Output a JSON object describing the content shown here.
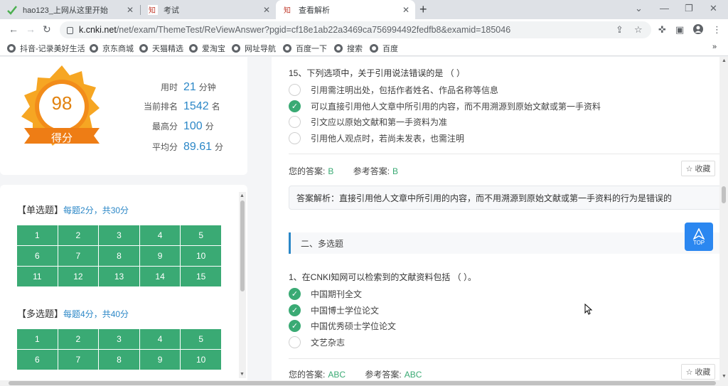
{
  "browser": {
    "tabs": [
      {
        "title": "hao123_上网从这里开始"
      },
      {
        "title": "考试"
      },
      {
        "title": "查看解析"
      }
    ],
    "url_host": "k.cnki.net",
    "url_path": "/net/exam/ThemeTest/ReViewAnswer?pgid=cf18e1ab22a3469ca756994492fedfb8&examid=185046",
    "bookmarks": [
      "抖音-记录美好生活",
      "京东商城",
      "天猫精选",
      "爱淘宝",
      "网址导航",
      "百度一下",
      "搜索",
      "百度"
    ],
    "more_bookmarks": "»"
  },
  "score": {
    "value": "98",
    "label": "得分",
    "stats": [
      {
        "label": "用时",
        "value": "21",
        "unit": "分钟"
      },
      {
        "label": "当前排名",
        "value": "1542",
        "unit": "名"
      },
      {
        "label": "最高分",
        "value": "100",
        "unit": "分"
      },
      {
        "label": "平均分",
        "value": "89.61",
        "unit": "分"
      }
    ]
  },
  "nav": {
    "single": {
      "title": "【单选题】",
      "note": "每题2分，共30分",
      "items": [
        "1",
        "2",
        "3",
        "4",
        "5",
        "6",
        "7",
        "8",
        "9",
        "10",
        "11",
        "12",
        "13",
        "14",
        "15"
      ]
    },
    "multi": {
      "title": "【多选题】",
      "note": "每题4分，共40分",
      "items": [
        "1",
        "2",
        "3",
        "4",
        "5",
        "6",
        "7",
        "8",
        "9",
        "10"
      ]
    }
  },
  "question15": {
    "title": "15、下列选项中，关于引用说法错误的是 （ ）",
    "options": [
      {
        "text": "引用需注明出处，包括作者姓名、作品名称等信息",
        "checked": false
      },
      {
        "text": "可以直接引用他人文章中所引用的内容，而不用溯源到原始文献或第一手资料",
        "checked": true
      },
      {
        "text": "引文应以原始文献和第一手资料为准",
        "checked": false
      },
      {
        "text": "引用他人观点时，若尚未发表，也需注明",
        "checked": false
      }
    ],
    "your_answer_label": "您的答案:",
    "your_answer": "B",
    "ref_answer_label": "参考答案:",
    "ref_answer": "B",
    "collect": "收藏",
    "analysis": "答案解析：直接引用他人文章中所引用的内容，而不用溯源到原始文献或第一手资料的行为是错误的"
  },
  "section2": {
    "title": "二、多选题"
  },
  "multi1": {
    "title": "1、在CNKI知网可以检索到的文献资料包括 （ ）。",
    "options": [
      {
        "text": "中国期刊全文",
        "checked": true
      },
      {
        "text": "中国博士学位论文",
        "checked": true
      },
      {
        "text": "中国优秀硕士学位论文",
        "checked": true
      },
      {
        "text": "文艺杂志",
        "checked": false
      }
    ],
    "your_answer_label": "您的答案:",
    "your_answer": "ABC",
    "ref_answer_label": "参考答案:",
    "ref_answer": "ABC",
    "collect": "收藏"
  },
  "top_button": "TOP",
  "colors": {
    "accent_green": "#3aaa74",
    "accent_blue": "#2b87c7",
    "medal_orange": "#f28c1a"
  }
}
